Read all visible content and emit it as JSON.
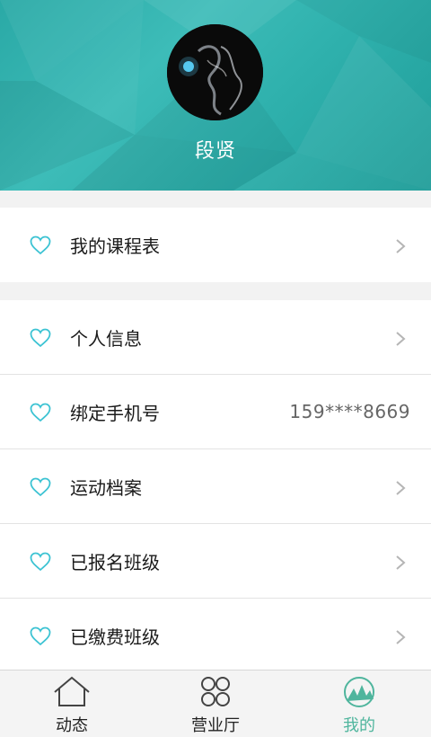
{
  "profile": {
    "name": "段贤"
  },
  "menu": {
    "group1": [
      {
        "label": "我的课程表",
        "icon": "heart-icon",
        "chevron": true
      }
    ],
    "group2": [
      {
        "label": "个人信息",
        "icon": "heart-icon",
        "chevron": true
      },
      {
        "label": "绑定手机号",
        "icon": "heart-icon",
        "value": "159****8669"
      },
      {
        "label": "运动档案",
        "icon": "heart-icon",
        "chevron": true
      },
      {
        "label": "已报名班级",
        "icon": "heart-icon",
        "chevron": true
      },
      {
        "label": "已缴费班级",
        "icon": "heart-icon",
        "chevron": true
      }
    ]
  },
  "tabs": [
    {
      "label": "动态",
      "icon": "home-icon",
      "active": false
    },
    {
      "label": "营业厅",
      "icon": "four-circles-icon",
      "active": false
    },
    {
      "label": "我的",
      "icon": "mountain-icon",
      "active": true
    }
  ],
  "colors": {
    "header_teal": "#2fb1ad",
    "heart_accent": "#3cc3d3",
    "active_tab": "#4fb59d"
  }
}
